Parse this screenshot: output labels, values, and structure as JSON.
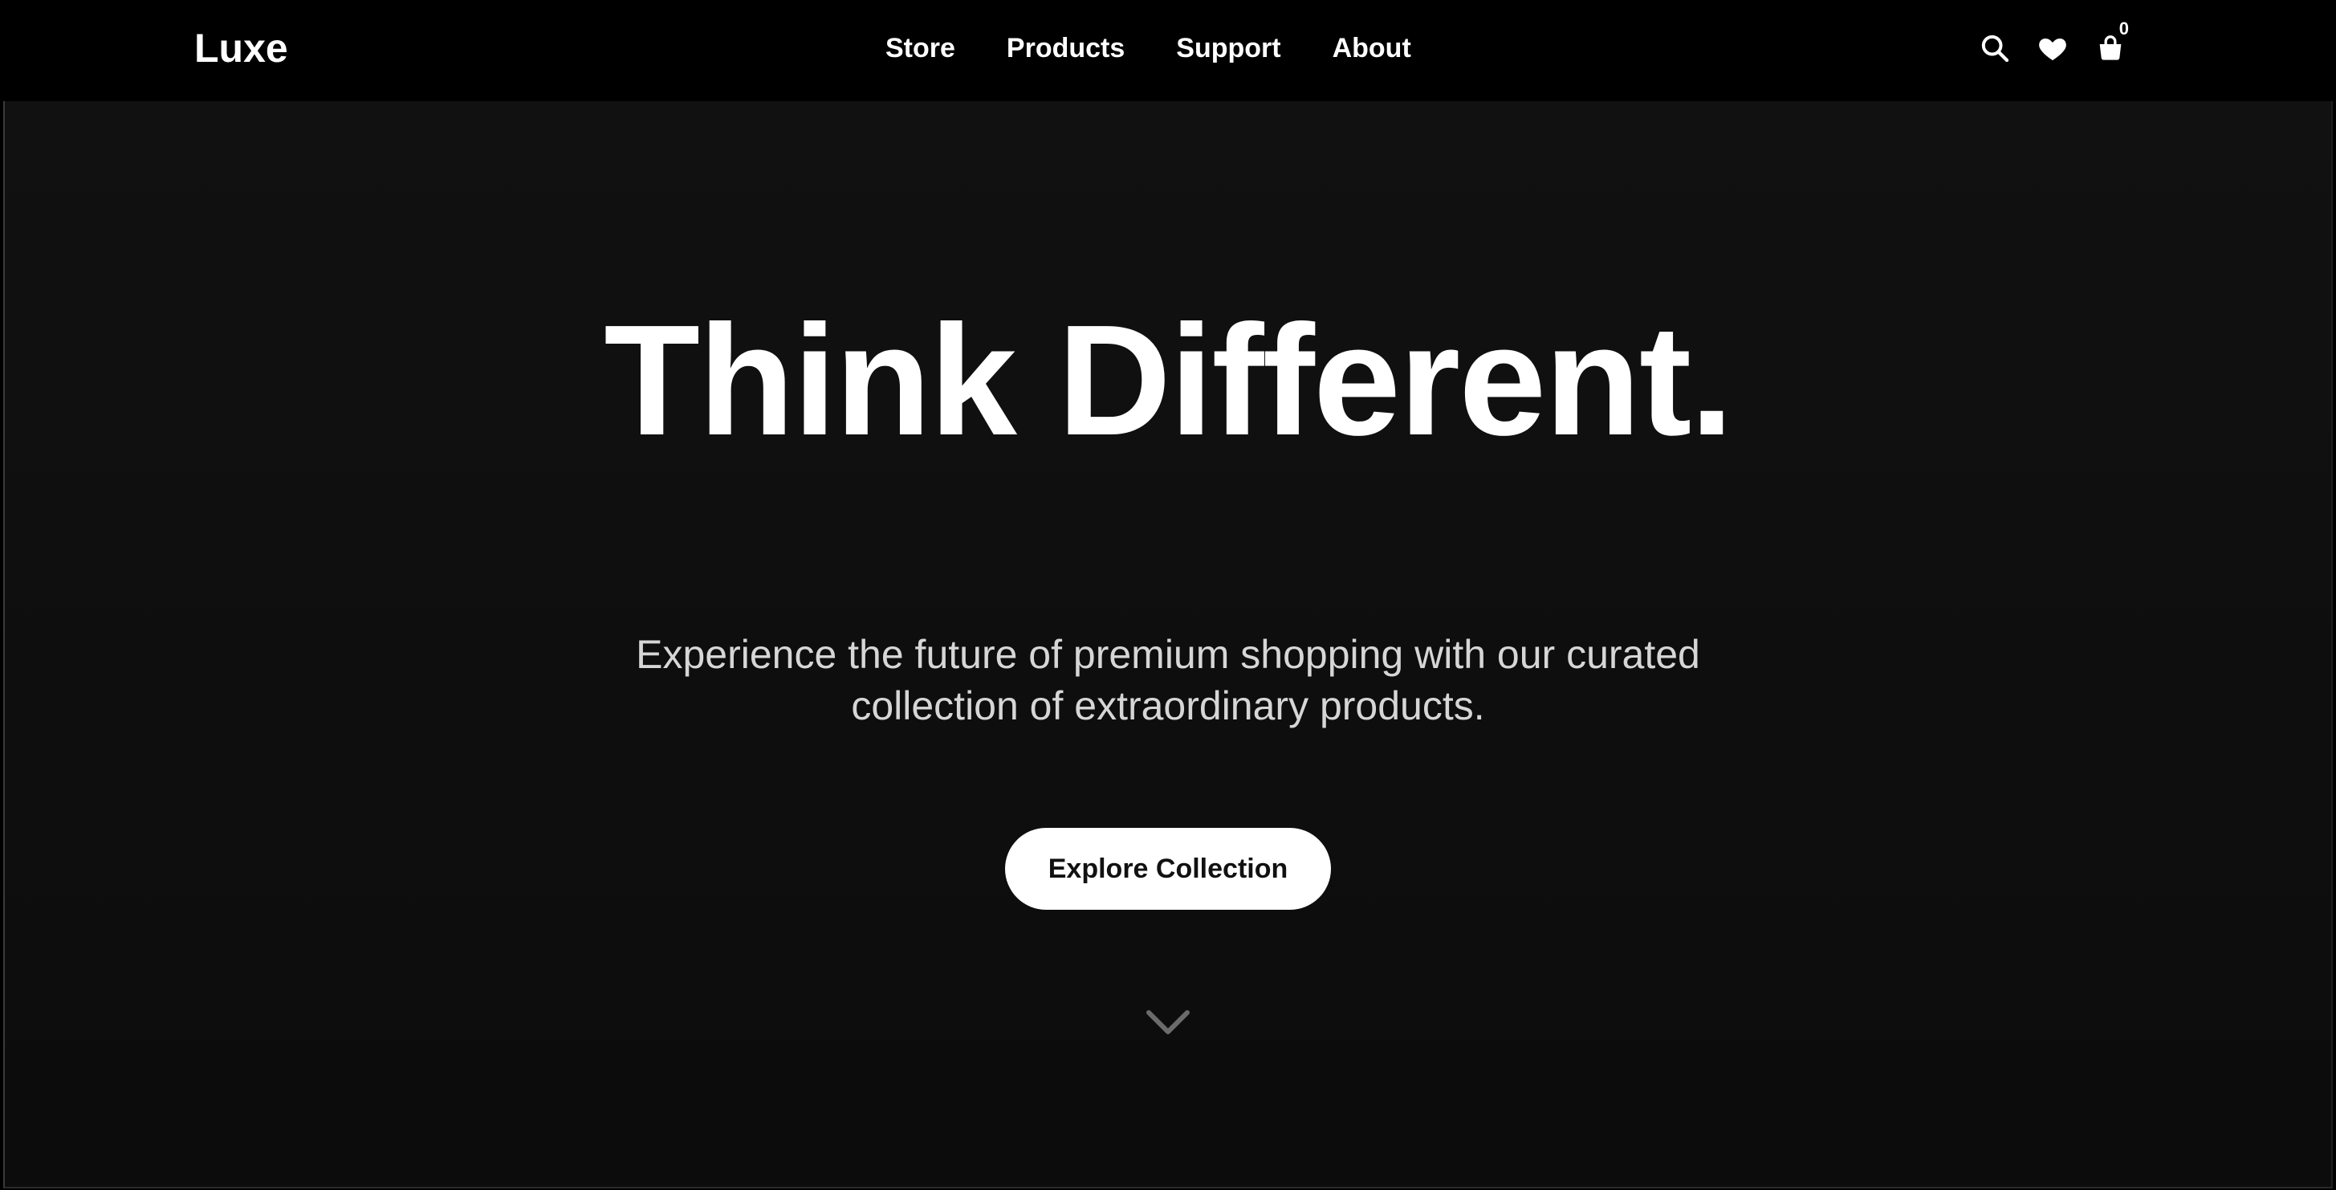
{
  "header": {
    "logo": "Luxe",
    "nav": [
      "Store",
      "Products",
      "Support",
      "About"
    ],
    "icons": [
      "search-icon",
      "heart-icon",
      "cart-icon"
    ],
    "cart_count": "0"
  },
  "hero": {
    "headline": "Think Different.",
    "subhead": "Experience the future of premium shopping with our curated\ncollection of extraordinary products.",
    "cta_label": "Explore Collection",
    "scroll_icon": "chevron-down-icon"
  },
  "colors": {
    "page_bg": "#000000",
    "hero_bg": "#0f0f0f",
    "text_primary": "#ffffff",
    "text_secondary": "#d6d6d6",
    "button_bg": "#ffffff",
    "button_text": "#111111",
    "chevron": "#6b6b6b"
  }
}
